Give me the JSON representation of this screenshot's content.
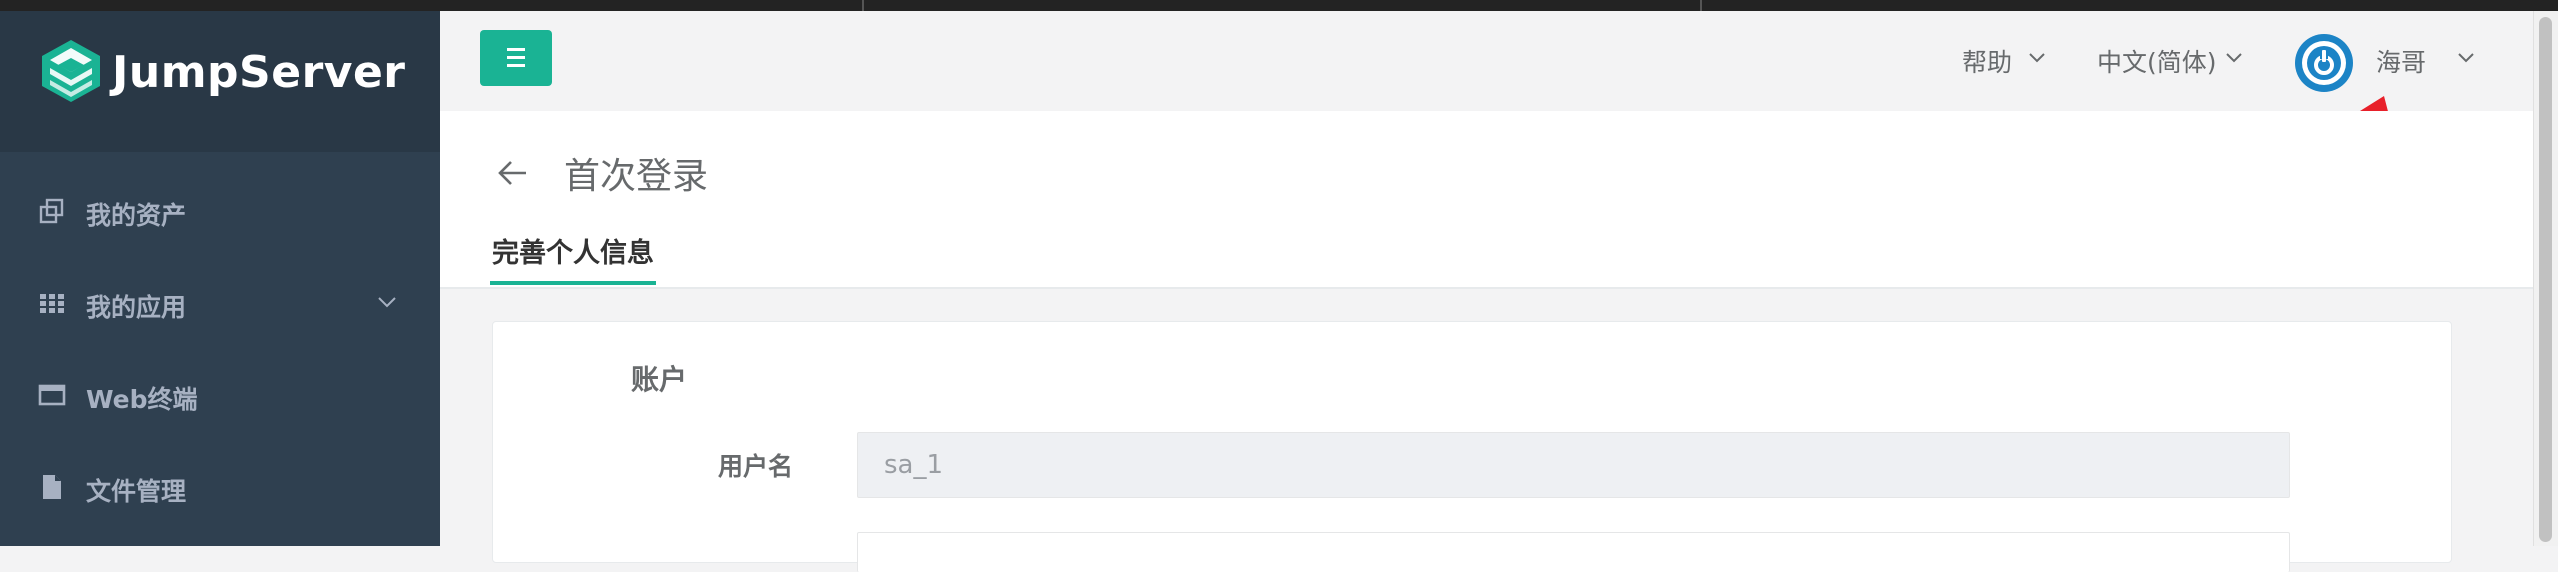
{
  "app": {
    "brand_name": "JumpServer"
  },
  "sidebar": {
    "items": [
      {
        "label": "我的资产",
        "icon": "assets-icon"
      },
      {
        "label": "我的应用",
        "icon": "grid-icon",
        "has_submenu": true
      },
      {
        "label": "Web终端",
        "icon": "terminal-window-icon"
      },
      {
        "label": "文件管理",
        "icon": "file-icon"
      }
    ]
  },
  "navbar": {
    "help_label": "帮助",
    "language_label": "中文(简体)",
    "user_name": "海哥"
  },
  "page": {
    "title": "首次登录",
    "tab_label": "完善个人信息"
  },
  "form": {
    "section_title": "账户",
    "username_label": "用户名",
    "username_value": "sa_1"
  },
  "colors": {
    "sidebar_bg": "#2f4050",
    "brand_bg": "#293846",
    "accent": "#1ab394",
    "avatar": "#1c84c6",
    "annotation_arrow": "#e8202a"
  }
}
